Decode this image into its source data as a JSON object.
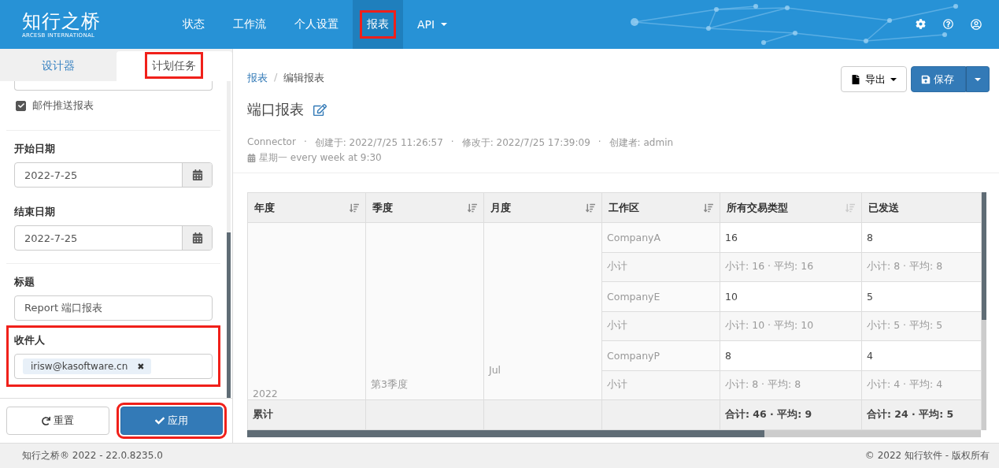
{
  "header": {
    "logo": "知行之桥",
    "logo_subtitle": "ARCESB INTERNATIONAL",
    "nav": [
      {
        "label": "状态",
        "selected": false,
        "highlighted": false,
        "dropdown": false
      },
      {
        "label": "工作流",
        "selected": false,
        "highlighted": false,
        "dropdown": false
      },
      {
        "label": "个人设置",
        "selected": false,
        "highlighted": false,
        "dropdown": false
      },
      {
        "label": "报表",
        "selected": true,
        "highlighted": true,
        "dropdown": false
      },
      {
        "label": "API",
        "selected": false,
        "highlighted": false,
        "dropdown": true
      }
    ]
  },
  "sidebar": {
    "tabs": [
      {
        "label": "设计器",
        "selected": false,
        "highlighted": false
      },
      {
        "label": "计划任务",
        "selected": true,
        "highlighted": true
      }
    ],
    "email_report": {
      "label": "邮件推送报表",
      "checked": true
    },
    "fields": [
      {
        "kind": "date",
        "label": "开始日期",
        "value": "2022-7-25"
      },
      {
        "kind": "date",
        "label": "结束日期",
        "value": "2022-7-25"
      },
      {
        "kind": "text",
        "label": "标题",
        "value": "Report 端口报表"
      },
      {
        "kind": "tags",
        "label": "收件人",
        "tags": [
          "irisw@kasoftware.cn"
        ],
        "remove_icon": "✖",
        "highlighted": true
      }
    ],
    "buttons": [
      {
        "kind": "reset",
        "label": "重置",
        "highlighted": false
      },
      {
        "kind": "apply",
        "label": "应用",
        "highlighted": true
      }
    ]
  },
  "breadcrumb": {
    "separator": "/",
    "items": [
      {
        "label": "报表",
        "link": true
      },
      {
        "label": "编辑报表",
        "link": false
      }
    ]
  },
  "toolbar": {
    "export": "导出",
    "save": "保存"
  },
  "report": {
    "title": "端口报表",
    "meta_separator": "·",
    "meta": [
      "Connector",
      "创建于: 2022/7/25 11:26:57",
      "修改于: 2022/7/25 17:39:09",
      "创建者: admin"
    ],
    "schedule": "星期一 every week at 9:30"
  },
  "table": {
    "columns": [
      {
        "label": "年度",
        "sort_active": true
      },
      {
        "label": "季度",
        "sort_active": true
      },
      {
        "label": "月度",
        "sort_active": true
      },
      {
        "label": "工作区",
        "sort_active": true
      },
      {
        "label": "所有交易类型",
        "sort_active": false
      },
      {
        "label": "已发送"
      }
    ],
    "groups": [
      "2022",
      "第3季度",
      "Jul"
    ],
    "rows": [
      {
        "kind": "value",
        "workspace": "CompanyA",
        "all_types": "16",
        "sent": "8"
      },
      {
        "kind": "subtotal",
        "workspace": "小计",
        "all_types": "小计: 16 · 平均: 16",
        "sent": "小计: 8 · 平均: 8"
      },
      {
        "kind": "value",
        "workspace": "CompanyE",
        "all_types": "10",
        "sent": "5"
      },
      {
        "kind": "subtotal",
        "workspace": "小计",
        "all_types": "小计: 10 · 平均: 10",
        "sent": "小计: 5 · 平均: 5"
      },
      {
        "kind": "value",
        "workspace": "CompanyP",
        "all_types": "8",
        "sent": "4"
      },
      {
        "kind": "subtotal",
        "workspace": "小计",
        "all_types": "小计: 8 · 平均: 8",
        "sent": "小计: 4 · 平均: 4"
      }
    ],
    "footer": {
      "label": "累计",
      "all_types": "合计: 46 · 平均: 9",
      "sent": "合计: 24 · 平均: 5"
    }
  },
  "status_bar": {
    "version": "知行之桥® 2022 - 22.0.8235.0",
    "copyright": "© 2022 知行软件 - 版权所有"
  }
}
